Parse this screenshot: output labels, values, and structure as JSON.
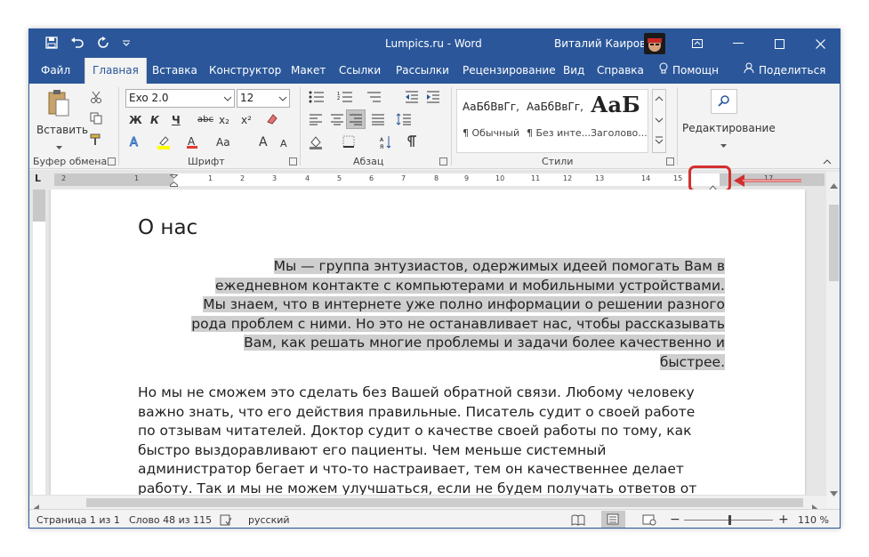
{
  "title_bar": {
    "doc_title": "Lumpics.ru",
    "separator": " - ",
    "app_name": "Word",
    "user_name": "Виталий Каиров",
    "qat_icons": [
      "save-icon",
      "undo-icon",
      "redo-icon",
      "customize-icon"
    ]
  },
  "tabs": [
    {
      "label": "Файл"
    },
    {
      "label": "Главная"
    },
    {
      "label": "Вставка"
    },
    {
      "label": "Конструктор"
    },
    {
      "label": "Макет"
    },
    {
      "label": "Ссылки"
    },
    {
      "label": "Рассылки"
    },
    {
      "label": "Рецензирование"
    },
    {
      "label": "Вид"
    },
    {
      "label": "Справка"
    }
  ],
  "tell_me": "Помощн",
  "share": "Поделиться",
  "ribbon": {
    "clipboard": {
      "paste_label": "Вставить",
      "group_label": "Буфер обмена"
    },
    "font": {
      "font_name": "Exo 2.0",
      "font_size": "12",
      "group_label": "Шрифт",
      "bold": "Ж",
      "italic": "К",
      "underline": "Ч",
      "strike": "abc",
      "sub": "x₂",
      "sup": "x²",
      "grow": "A",
      "shrink": "A",
      "case": "Aa"
    },
    "paragraph": {
      "group_label": "Абзац"
    },
    "styles": {
      "group_label": "Стили",
      "items": [
        {
          "sample": "АаБбВвГг,",
          "name": "¶ Обычный"
        },
        {
          "sample": "АаБбВвГг,",
          "name": "¶ Без инте..."
        },
        {
          "sample": "АаБ",
          "name": "Заголово..."
        }
      ]
    },
    "editing": {
      "label": "Редактирование"
    }
  },
  "ruler": {
    "tab_marker": "L",
    "numbers": [
      "2",
      "1",
      "1",
      "2",
      "3",
      "4",
      "5",
      "6",
      "7",
      "8",
      "9",
      "10",
      "11",
      "12",
      "13",
      "14",
      "15",
      "17"
    ]
  },
  "document": {
    "heading": "О нас",
    "para_right_lines": [
      "Мы — группа энтузиастов, одержимых идеей помогать Вам в",
      "ежедневном контакте с компьютерами и мобильными устройствами.",
      "Мы знаем, что в интернете уже полно информации о решении разного",
      "рода проблем с ними. Но это не останавливает нас, чтобы рассказывать",
      "Вам, как решать многие проблемы и задачи более качественно и",
      "быстрее."
    ],
    "para_left_lines": [
      "Но мы не сможем это сделать без Вашей обратной связи. Любому человеку",
      "важно знать, что его действия правильные. Писатель судит о своей работе",
      "по отзывам читателей. Доктор судит о качестве своей работы по тому, как",
      "быстро выздоравливают его пациенты. Чем меньше системный",
      "администратор бегает и что-то настраивает, тем он качественнее делает",
      "работу. Так и мы не можем улучшаться, если не будем получать ответов от"
    ]
  },
  "status_bar": {
    "page": "Страница 1 из 1",
    "words": "Слово 48 из 115",
    "language": "русский",
    "zoom_minus": "−",
    "zoom_plus": "+",
    "zoom": "110 %",
    "zoom_level": 1.1
  },
  "colors": {
    "accent": "#2b579a",
    "highlight": "#cfcfcf",
    "callout": "#d32f2f"
  }
}
